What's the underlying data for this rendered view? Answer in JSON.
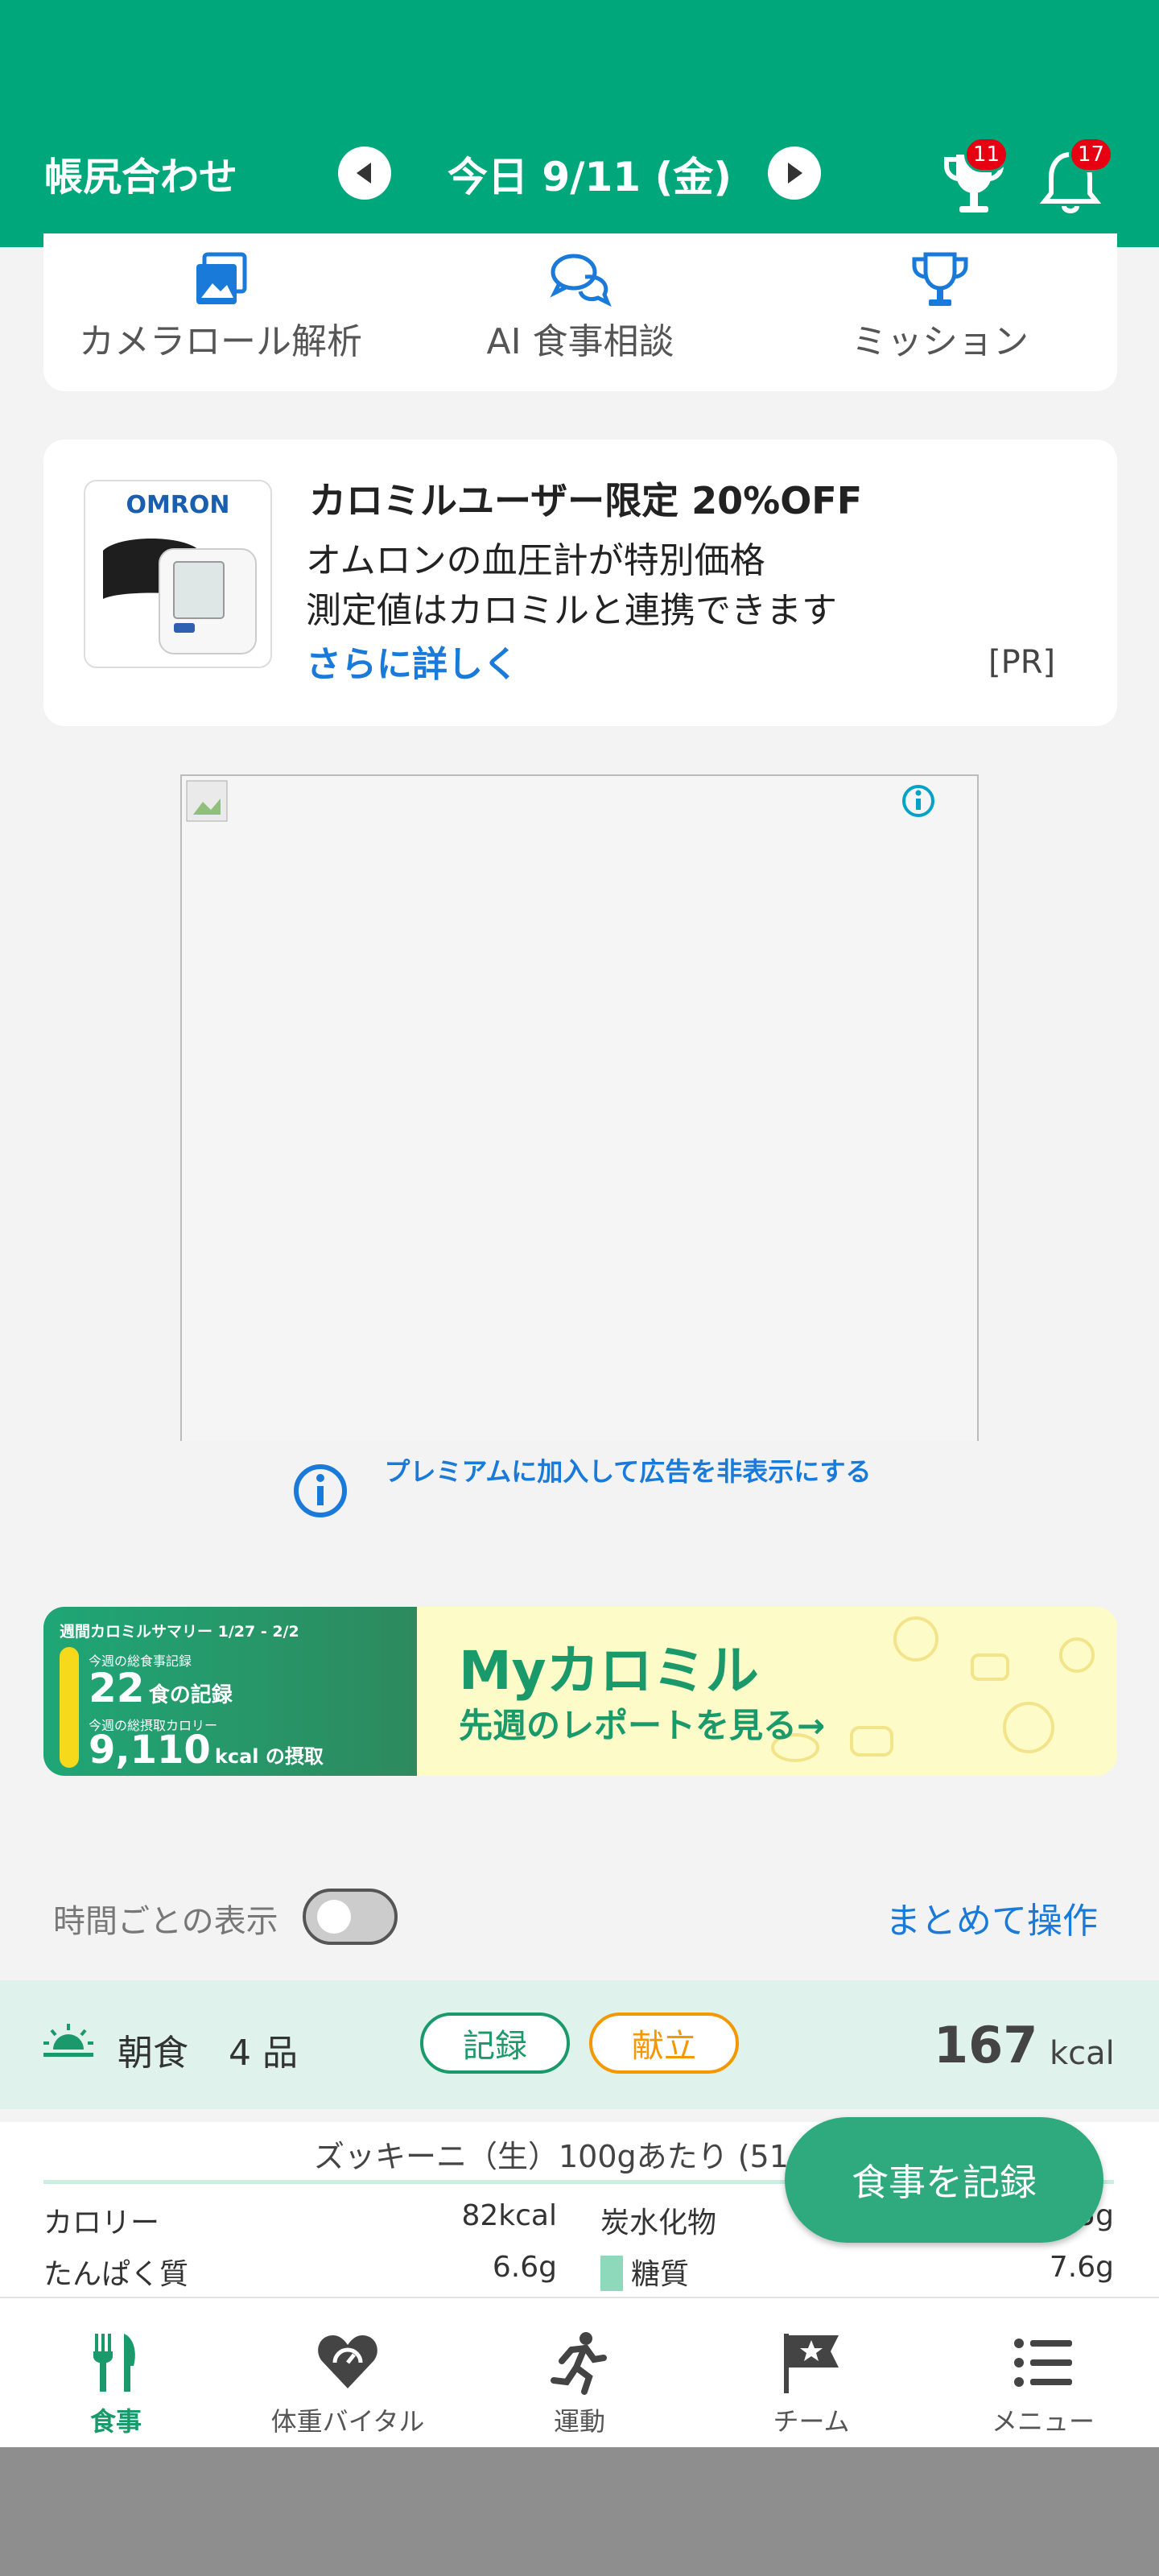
{
  "header": {
    "title": "帳尻合わせ",
    "date": "今日 9/11 (金)",
    "trophy_badge": "11",
    "bell_badge": "17"
  },
  "quick_actions": [
    {
      "label": "カメラロール解析",
      "icon": "gallery-icon"
    },
    {
      "label": "AI 食事相談",
      "icon": "chat-icon"
    },
    {
      "label": "ミッション",
      "icon": "trophy-icon"
    }
  ],
  "promo": {
    "brand": "OMRON",
    "title": "カロミルユーザー限定 20%OFF",
    "line1": "オムロンの血圧計が特別価格",
    "line2": "測定値はカロミルと連携できます",
    "link": "さらに詳しく",
    "pr": "[PR]"
  },
  "premium_text": "プレミアムに加入して広告を非表示にする",
  "banner": {
    "summary_title": "週間カロミルサマリー 1/27 - 2/2",
    "meal_count_label": "今週の総食事記録",
    "meal_count": "22",
    "meal_count_unit": "食の記録",
    "kcal_label": "今週の総摂取カロリー",
    "kcal_value": "9,110",
    "kcal_unit": "kcal の摂取",
    "brand_my": "My",
    "brand_name": "カロミル",
    "cta": "先週のレポートを見る→"
  },
  "controls": {
    "toggle_label": "時間ごとの表示",
    "toggle_on": false,
    "bulk_action": "まとめて操作"
  },
  "meal": {
    "name": "朝食",
    "count": "4 品",
    "record_btn": "記録",
    "menu_btn": "献立",
    "kcal": "167",
    "kcal_unit": "kcal"
  },
  "nutrition": {
    "header": "ズッキーニ（生）100gあたり (51",
    "rows": [
      {
        "left_label": "カロリー",
        "left_value": "82kcal",
        "right_label": "炭水化物",
        "right_value": "5g"
      },
      {
        "left_label": "たんぱく質",
        "left_value": "6.6g",
        "right_label": "糖質",
        "right_value": "7.6g"
      }
    ]
  },
  "fab_label": "食事を記録",
  "tabs": [
    {
      "label": "食事",
      "icon": "fork-knife-icon",
      "active": true
    },
    {
      "label": "体重バイタル",
      "icon": "heart-scale-icon",
      "active": false
    },
    {
      "label": "運動",
      "icon": "running-icon",
      "active": false
    },
    {
      "label": "チーム",
      "icon": "flag-icon",
      "active": false
    },
    {
      "label": "メニュー",
      "icon": "list-icon",
      "active": false
    }
  ],
  "colors": {
    "brand_green": "#00a77a",
    "link_blue": "#1a7ad9",
    "badge_red": "#e60012",
    "menu_orange": "#f39800"
  }
}
